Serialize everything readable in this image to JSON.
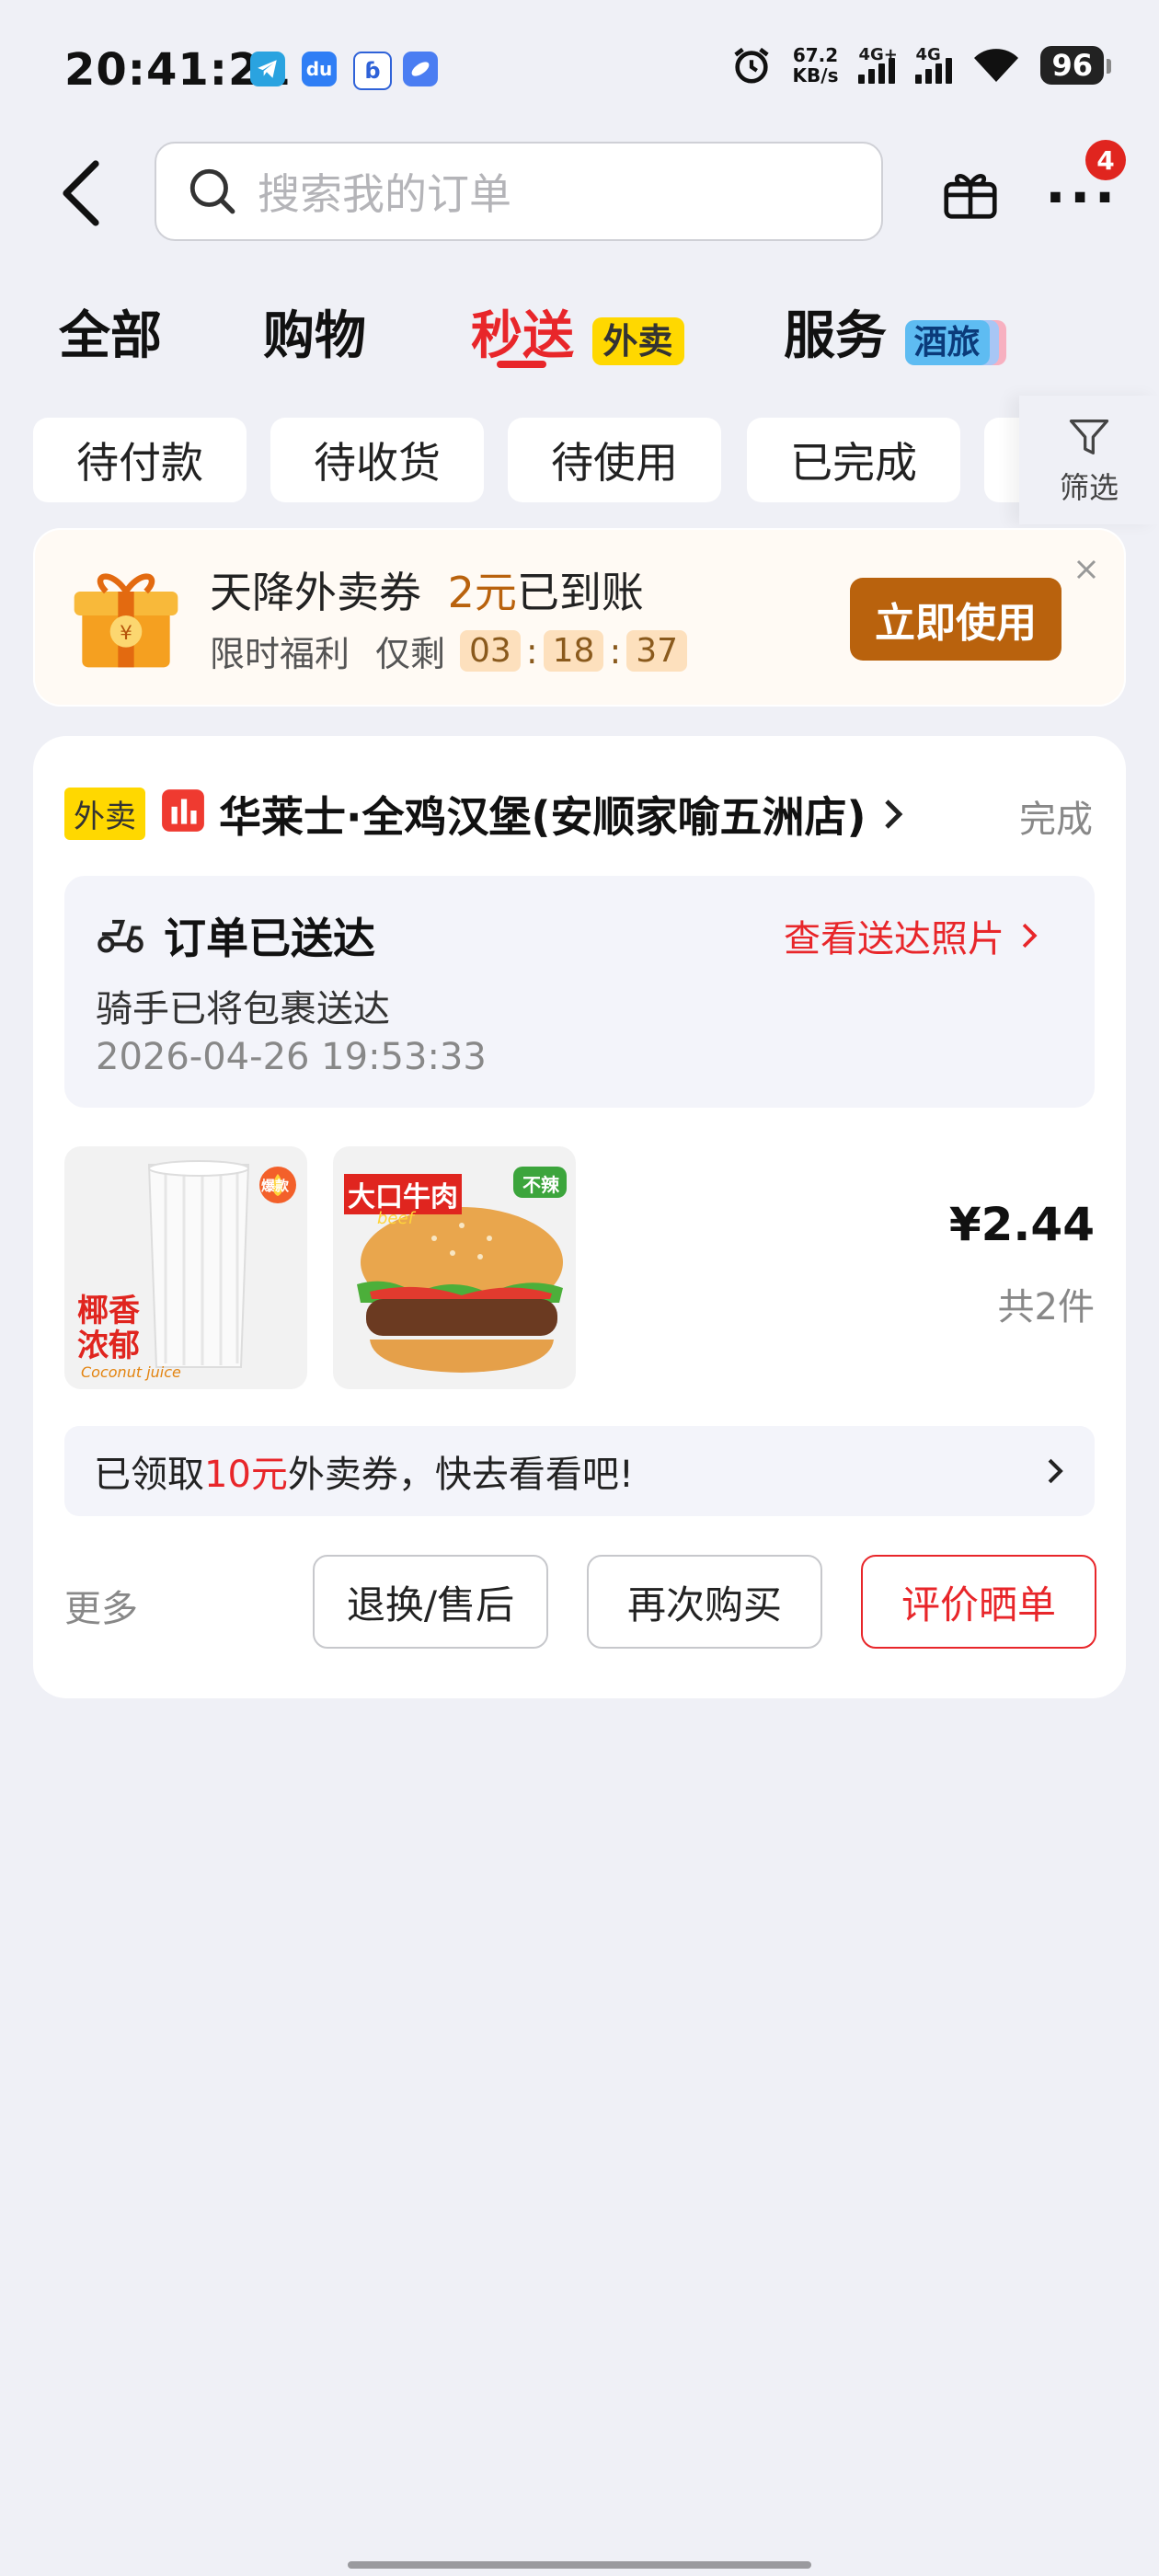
{
  "status_bar": {
    "time": "20:41:21",
    "app_icons": [
      "telegram-icon",
      "baidu-netdisk-icon",
      "baidu-icon",
      "pill-app-icon"
    ],
    "alarm_icon": "alarm-clock-icon",
    "net_speed_value": "67.2",
    "net_speed_unit": "KB/s",
    "signal1_label": "4G+",
    "signal2_label": "4G",
    "wifi_icon": "wifi-icon",
    "battery": "96"
  },
  "header": {
    "search_placeholder": "搜索我的订单",
    "notification_badge": "4"
  },
  "tabs": [
    {
      "label": "全部"
    },
    {
      "label": "购物"
    },
    {
      "label": "秒送",
      "tag": "外卖"
    },
    {
      "label": "服务",
      "tag": "酒旅"
    }
  ],
  "active_tab_color": "#e8262a",
  "sub_filters": [
    "待付款",
    "待收货",
    "待使用",
    "已完成"
  ],
  "filter_label": "筛选",
  "banner": {
    "title_prefix": "天降外卖券",
    "amount": "2元",
    "title_suffix": "已到账",
    "subtitle_1": "限时福利",
    "subtitle_2": "仅剩",
    "countdown": [
      "03",
      "18",
      "37"
    ],
    "button": "立即使用",
    "accent_color": "#b9620d"
  },
  "order": {
    "tag": "外卖",
    "shop_name": "华莱士·全鸡汉堡(安顺家喻五洲店)",
    "status": "完成",
    "delivery_title": "订单已送达",
    "delivery_link": "查看送达照片",
    "delivery_desc": "骑手已将包裹送达",
    "delivery_time": "2026-04-26 19:53:33",
    "products": [
      {
        "name": "椰香浓郁",
        "sub_text": "Coconut juice",
        "badge": "爆款"
      },
      {
        "name": "大口牛肉",
        "sub_text": "beef",
        "badge": "不辣"
      }
    ],
    "price": "¥2.44",
    "quantity": "共2件",
    "coupon_prefix": "已领取",
    "coupon_amount": "10元",
    "coupon_suffix": "外卖券，快去看看吧!",
    "more": "更多",
    "buttons": [
      "退换/售后",
      "再次购买",
      "评价晒单"
    ]
  }
}
